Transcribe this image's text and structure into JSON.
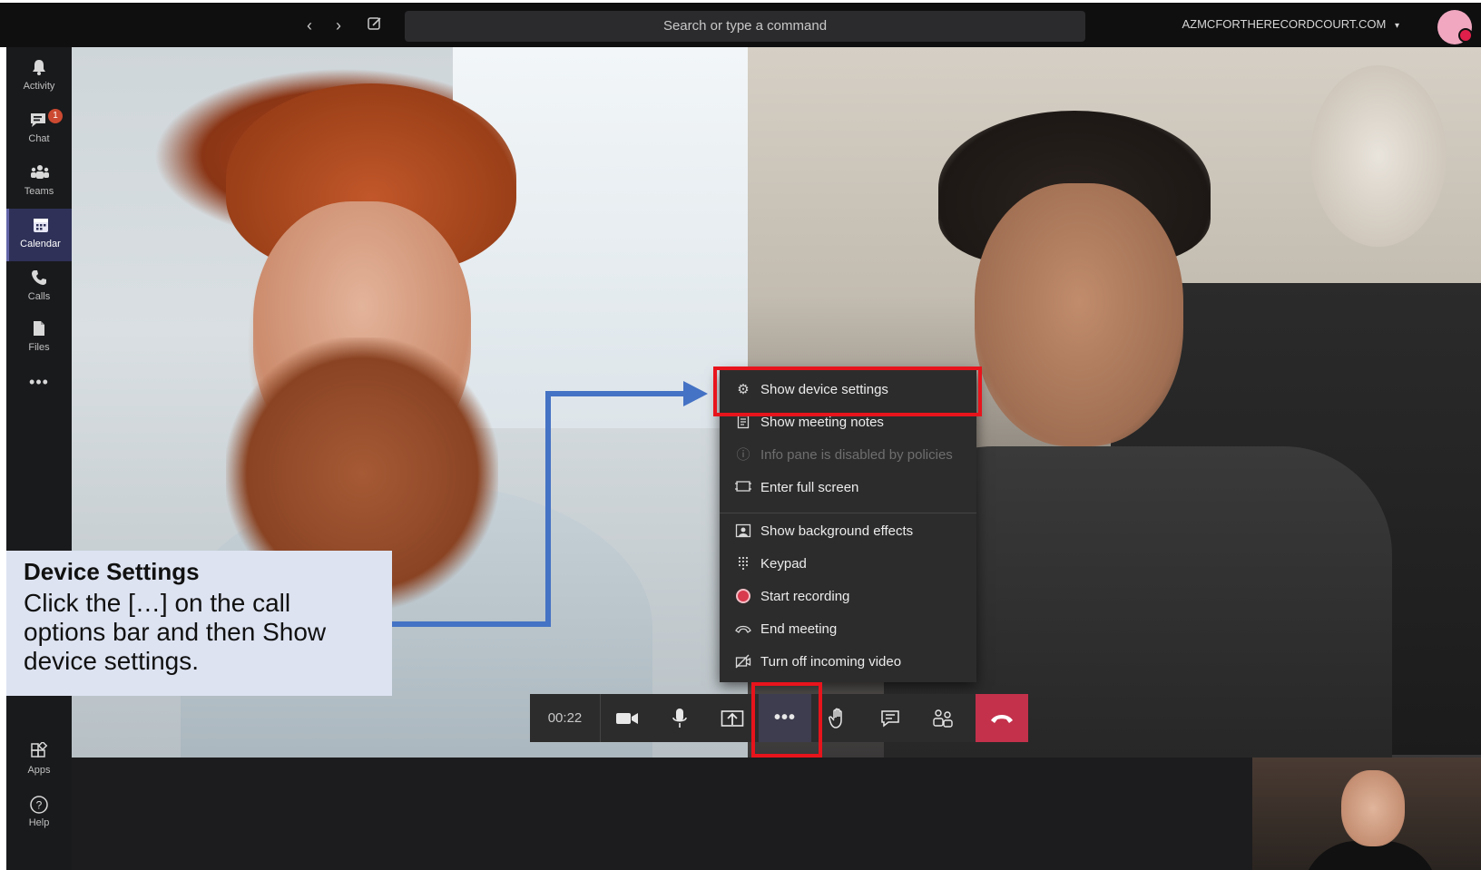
{
  "topbar": {
    "search_placeholder": "Search or type a command",
    "org_name": "AZMCFORTHERECORDCOURT.COM",
    "org_chevron": "chevron-down-icon"
  },
  "rail": {
    "items": [
      {
        "label": "Activity",
        "icon": "bell-icon"
      },
      {
        "label": "Chat",
        "icon": "chat-icon",
        "badge": "1"
      },
      {
        "label": "Teams",
        "icon": "teams-icon"
      },
      {
        "label": "Calendar",
        "icon": "calendar-icon",
        "active": true
      },
      {
        "label": "Calls",
        "icon": "phone-icon"
      },
      {
        "label": "Files",
        "icon": "file-icon"
      },
      {
        "label": "",
        "icon": "more-icon"
      },
      {
        "label": "Apps",
        "icon": "apps-icon"
      },
      {
        "label": "Help",
        "icon": "help-icon"
      }
    ]
  },
  "menu": {
    "items": [
      {
        "label": "Show device settings",
        "icon": "gear-icon"
      },
      {
        "label": "Show meeting notes",
        "icon": "notes-icon"
      },
      {
        "label": "Info pane is disabled by policies",
        "icon": "info-icon",
        "disabled": true
      },
      {
        "label": "Enter full screen",
        "icon": "fullscreen-icon"
      },
      {
        "label": "Show background effects",
        "icon": "background-effects-icon"
      },
      {
        "label": "Keypad",
        "icon": "keypad-icon"
      },
      {
        "label": "Start recording",
        "icon": "record-icon"
      },
      {
        "label": "End meeting",
        "icon": "end-meeting-icon"
      },
      {
        "label": "Turn off incoming video",
        "icon": "video-off-icon"
      }
    ]
  },
  "callbar": {
    "timer": "00:22"
  },
  "callout": {
    "title": "Device Settings",
    "text_1": "Click the […] on the call options bar and then ",
    "text_bold": "Show device settings",
    "text_2": "."
  },
  "colors": {
    "accent": "#6264a7",
    "annotation_red": "#e8141c",
    "annotation_arrow": "#4472c4",
    "hangup": "#c4314b",
    "callout_bg": "#dde3f1"
  }
}
